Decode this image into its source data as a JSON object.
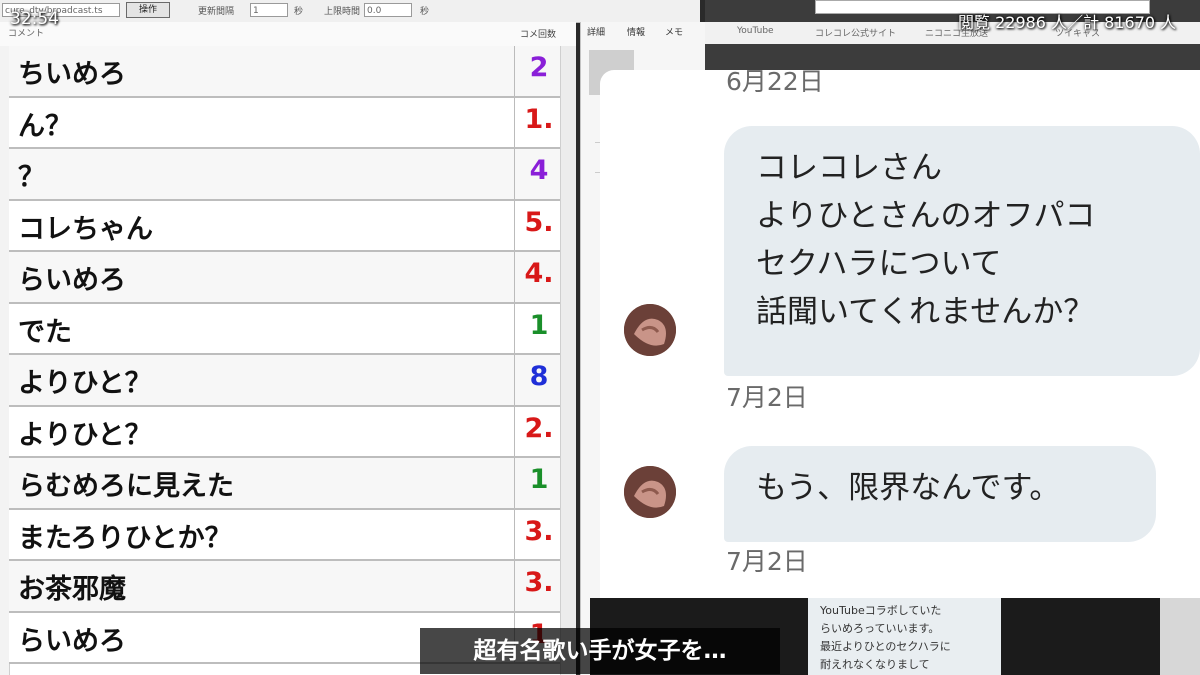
{
  "overlay": {
    "timer": "32:54",
    "stats": "閲覧 22986 人／計 81670 人",
    "subtitle": "超有名歌い手が女子を…"
  },
  "toolbar": {
    "path_value": "cure_dtv/broadcast.ts",
    "button_label": "操作",
    "interval_label": "更新間隔",
    "interval_value": "1",
    "threshold_label": "上限時間",
    "threshold_value": "0.0",
    "seconds_unit": "秒"
  },
  "comments": {
    "header_comment": "コメント",
    "header_count": "コメ回数",
    "rows": [
      {
        "text": "ちいめろ",
        "count": "2",
        "color": "#8a1fd8"
      },
      {
        "text": "ん？",
        "count": "1.",
        "color": "#d81818"
      },
      {
        "text": "？",
        "count": "4",
        "color": "#8a1fd8"
      },
      {
        "text": "コレちゃん",
        "count": "5.",
        "color": "#d81818"
      },
      {
        "text": "らいめろ",
        "count": "4.",
        "color": "#d81818"
      },
      {
        "text": "でた",
        "count": "1",
        "color": "#1a8f2a"
      },
      {
        "text": "よりひと？",
        "count": "8",
        "color": "#1f2fd8"
      },
      {
        "text": "よりひと？",
        "count": "2.",
        "color": "#d81818"
      },
      {
        "text": "らむめろに見えた",
        "count": "1",
        "color": "#1a8f2a"
      },
      {
        "text": "またろりひとか？",
        "count": "3.",
        "color": "#d81818"
      },
      {
        "text": "お茶邪魔",
        "count": "3.",
        "color": "#d81818"
      },
      {
        "text": "らいめろ",
        "count": "1",
        "color": "#d81818"
      }
    ]
  },
  "detail": {
    "tabs": [
      "詳細",
      "情報",
      "メモ"
    ]
  },
  "browser": {
    "bookmarks": [
      "YouTube",
      "コレコレ公式サイト",
      "ニコニコ生放送",
      "ツイキャス"
    ]
  },
  "dm": {
    "top_date": "6月22日",
    "messages": [
      {
        "lines": [
          "コレコレさん",
          "よりひとさんのオフパコ",
          "セクハラについて",
          "話聞いてくれませんか？"
        ],
        "date": "7月2日"
      },
      {
        "lines": [
          "もう、限界なんです。"
        ],
        "date": "7月2日"
      }
    ]
  },
  "thumbnail": {
    "lines": [
      "YouTubeコラボしていた",
      "らいめろっていいます。",
      "最近よりひとのセクハラに",
      "耐えれなくなりまして"
    ]
  }
}
